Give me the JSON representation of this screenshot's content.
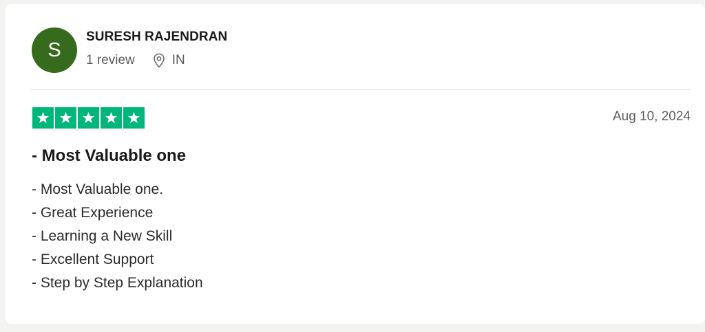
{
  "reviewer": {
    "avatar_initial": "S",
    "avatar_color": "#366a1d",
    "name": "SURESH RAJENDRAN",
    "review_count": "1 review",
    "location_icon": "map-pin-icon",
    "country": "IN"
  },
  "review": {
    "rating": 5,
    "rating_max": 5,
    "star_color": "#00b67a",
    "date": "Aug 10, 2024",
    "title": "- Most Valuable one",
    "body_lines": [
      "- Most Valuable one.",
      "- Great Experience",
      "- Learning a New Skill",
      "- Excellent Support",
      "- Step by Step Explanation"
    ]
  }
}
